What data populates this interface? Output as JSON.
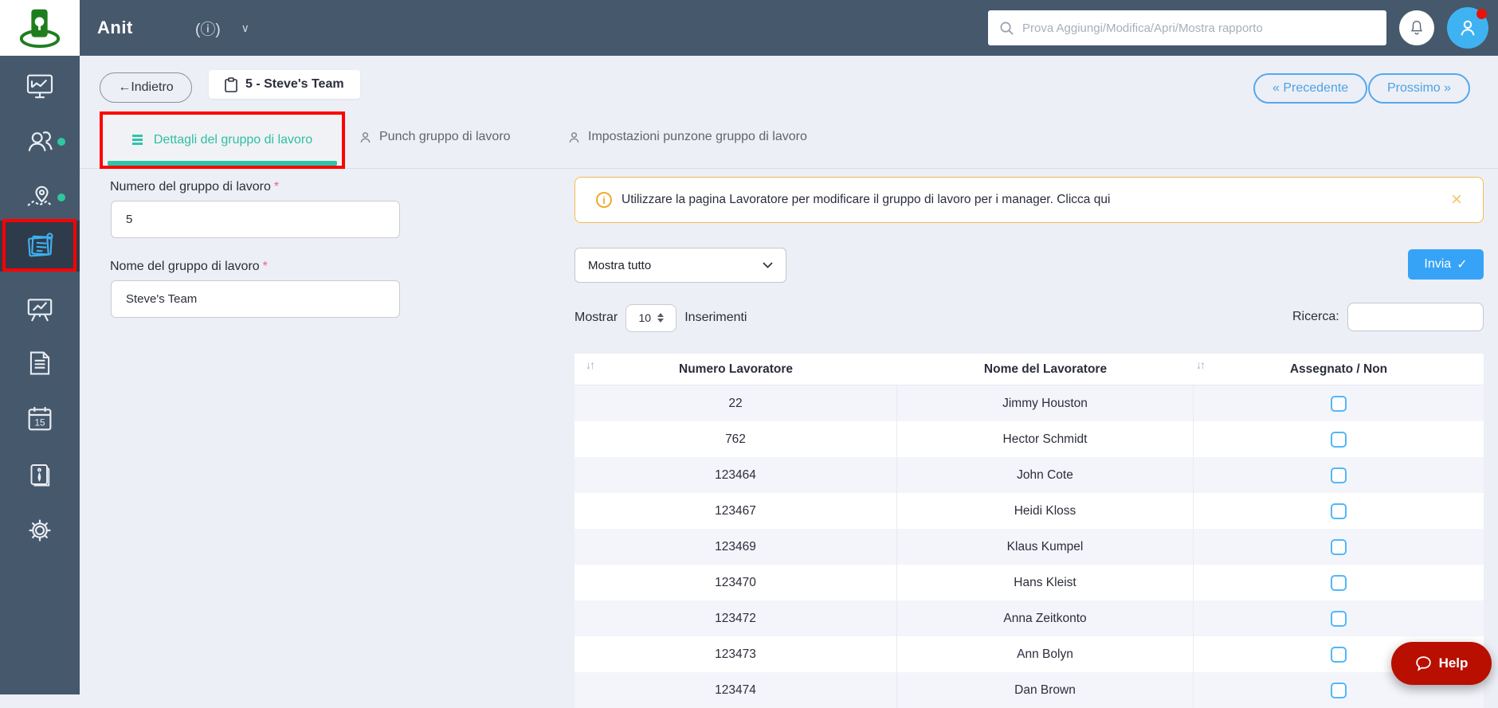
{
  "header": {
    "app_title": "Anit",
    "search_placeholder": "Prova Aggiungi/Modifica/Apri/Mostra rapporto",
    "lang_icon": "(ⓘ)",
    "chevron": "∨"
  },
  "sidebar": {
    "items": [
      {
        "name": "dashboard"
      },
      {
        "name": "workers",
        "badge": true
      },
      {
        "name": "map-tracking",
        "badge": true
      },
      {
        "name": "work-groups",
        "active": true,
        "annotated": true
      },
      {
        "name": "reports-board"
      },
      {
        "name": "documents"
      },
      {
        "name": "calendar",
        "calendar_day": "15"
      },
      {
        "name": "guide"
      },
      {
        "name": "settings"
      }
    ]
  },
  "toolbar": {
    "back_arrow": "←",
    "back_label": "Indietro",
    "team_chip": "5 - Steve's Team",
    "prev_label": "« Precedente",
    "next_label": "Prossimo »"
  },
  "tabs": [
    {
      "label": "Dettagli del gruppo di lavoro",
      "active": true,
      "annotated": true
    },
    {
      "label": "Punch gruppo di lavoro",
      "active": false
    },
    {
      "label": "Impostazioni punzone gruppo di lavoro",
      "active": false
    }
  ],
  "form": {
    "group_number_label": "Numero del gruppo di lavoro",
    "required_mark": "*",
    "group_number_value": "5",
    "group_name_label": "Nome del gruppo di lavoro",
    "group_name_value": "Steve's Team"
  },
  "alert": {
    "icon": "i",
    "text": "Utilizzare la pagina Lavoratore per modificare il gruppo di lavoro per i manager.  Clicca qui",
    "close": "×"
  },
  "filter": {
    "show_all_value": "Mostra tutto",
    "submit_label": "Invia",
    "submit_check": "✓",
    "show_label": "Mostrar",
    "page_size_value": "10",
    "entries_label": "Inserimenti",
    "search_label": "Ricerca:",
    "search_value": ""
  },
  "table": {
    "columns": [
      "Numero Lavoratore",
      "Nome del Lavoratore",
      "Assegnato / Non"
    ],
    "sort_glyph": "↓↑",
    "rows": [
      {
        "number": "22",
        "name": "Jimmy Houston",
        "checked": false
      },
      {
        "number": "762",
        "name": "Hector Schmidt",
        "checked": false
      },
      {
        "number": "123464",
        "name": "John Cote",
        "checked": false
      },
      {
        "number": "123467",
        "name": "Heidi Kloss",
        "checked": false
      },
      {
        "number": "123469",
        "name": "Klaus Kumpel",
        "checked": false
      },
      {
        "number": "123470",
        "name": "Hans Kleist",
        "checked": false
      },
      {
        "number": "123472",
        "name": "Anna Zeitkonto",
        "checked": false
      },
      {
        "number": "123473",
        "name": "Ann Bolyn",
        "checked": false
      },
      {
        "number": "123474",
        "name": "Dan Brown",
        "checked": false
      }
    ]
  },
  "help": {
    "label": "Help"
  },
  "colors": {
    "header_bg": "#46586c",
    "sidebar_active_bg": "#2e3b4b",
    "accent_teal": "#2ec5a8",
    "accent_blue": "#36a3f7",
    "annotation_red": "#fe0000",
    "alert_border": "#f3bb53",
    "help_red": "#b80f00",
    "logo_green": "#1e7e1e",
    "row_alt": "#f4f5fb"
  }
}
